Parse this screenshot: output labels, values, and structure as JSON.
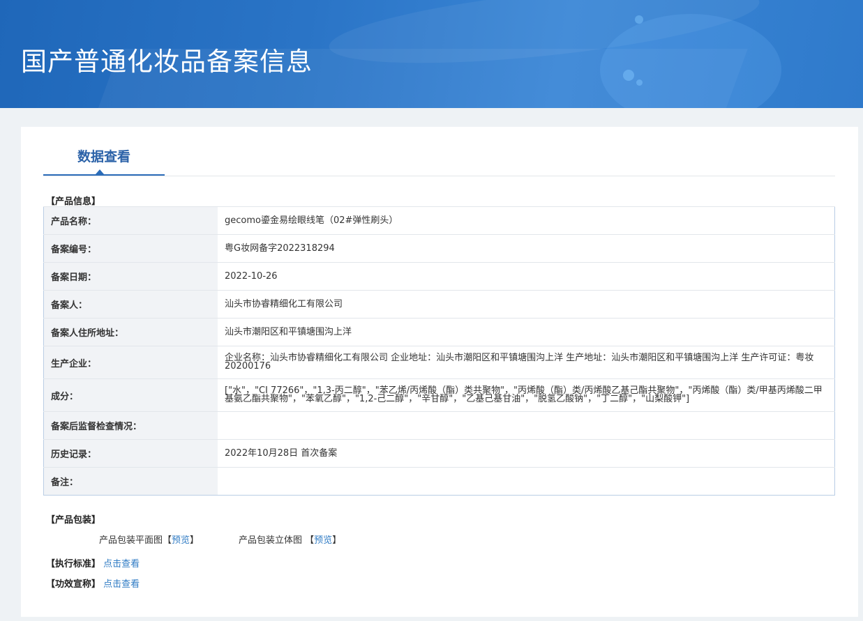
{
  "banner": {
    "title": "国产普通化妆品备案信息"
  },
  "tab": {
    "label": "数据查看"
  },
  "sections": {
    "product_info": "【产品信息】",
    "packaging": "【产品包装】"
  },
  "rows": [
    {
      "key": "产品名称：",
      "value": "gecomo鎏金易绘眼线笔（02#弹性刷头）"
    },
    {
      "key": "备案编号：",
      "value": "粤G妆网备字2022318294"
    },
    {
      "key": "备案日期：",
      "value": "2022-10-26"
    },
    {
      "key": "备案人：",
      "value": "汕头市协睿精细化工有限公司"
    },
    {
      "key": "备案人住所地址：",
      "value": "汕头市潮阳区和平镇塘围沟上洋"
    },
    {
      "key": "生产企业：",
      "value": "企业名称：汕头市协睿精细化工有限公司 企业地址：汕头市潮阳区和平镇塘围沟上洋 生产地址：汕头市潮阳区和平镇塘围沟上洋 生产许可证：粤妆20200176"
    },
    {
      "key": "成分：",
      "value": "[\"水\"，\"CI 77266\"，\"1,3-丙二醇\"，\"苯乙烯/丙烯酸（酯）类共聚物\"，\"丙烯酸（酯）类/丙烯酸乙基己酯共聚物\"，\"丙烯酸（酯）类/甲基丙烯酸二甲基氨乙酯共聚物\"，\"苯氧乙醇\"，\"1,2-己二醇\"，\"辛甘醇\"，\"乙基己基甘油\"，\"脱氢乙酸钠\"，\"丁二醇\"，\"山梨酸钾\"]"
    },
    {
      "key": "备案后监督检查情况：",
      "value": ""
    },
    {
      "key": "历史记录：",
      "value": "2022年10月28日 首次备案"
    },
    {
      "key": "备注：",
      "value": ""
    }
  ],
  "packaging": {
    "flat_label": "产品包装平面图",
    "solid_label": "产品包装立体图",
    "bracket_open": "【",
    "bracket_close": "】",
    "preview": "预览"
  },
  "standard": {
    "label": "【执行标准】",
    "link": "点击查看"
  },
  "efficacy": {
    "label": "【功效宣称】",
    "link": "点击查看"
  }
}
